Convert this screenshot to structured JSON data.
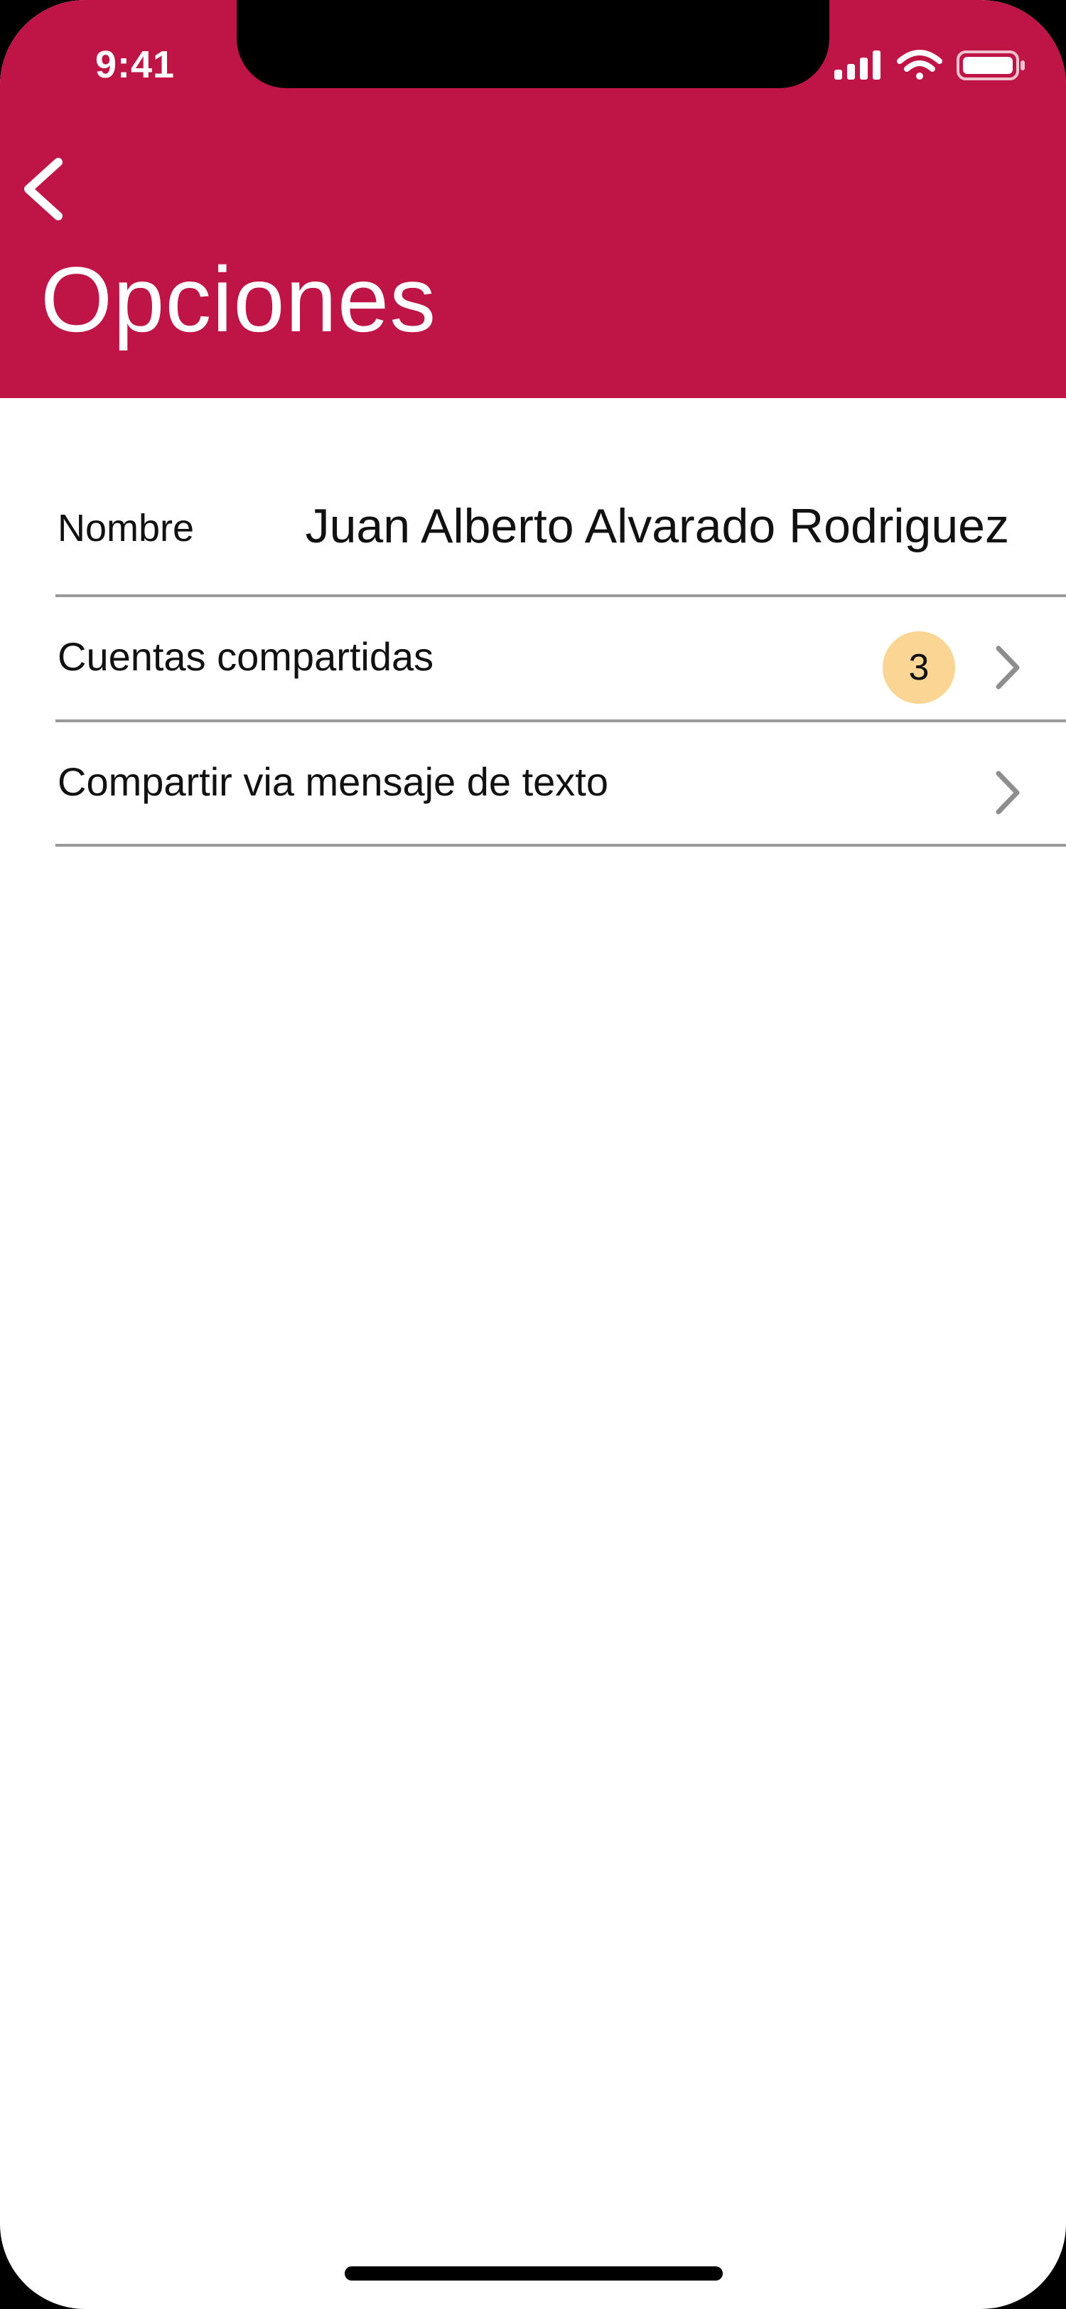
{
  "status_bar": {
    "time": "9:41",
    "icons": [
      "signal-icon",
      "wifi-icon",
      "battery-icon"
    ]
  },
  "header": {
    "back_icon": "chevron-left-icon",
    "title": "Opciones"
  },
  "options": {
    "name_label": "Nombre",
    "name_value": "Juan Alberto Alvarado Rodriguez",
    "shared_accounts_label": "Cuentas compartidas",
    "shared_accounts_count": "3",
    "share_sms_label": "Compartir via mensaje de texto"
  },
  "colors": {
    "header": "#be1446",
    "badge": "#fbd593",
    "divider": "#9a9a9a",
    "chevron": "#8e8e8e"
  }
}
